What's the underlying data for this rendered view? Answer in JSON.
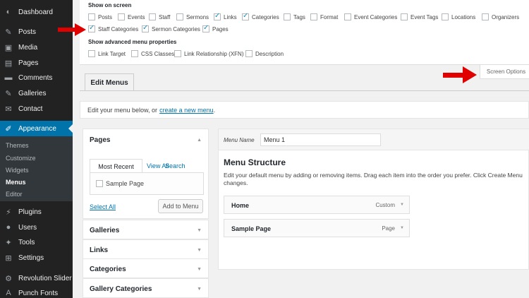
{
  "sidebar": {
    "items": [
      {
        "label": "Dashboard",
        "icon": "dashboard-icon",
        "glyph": "◐"
      },
      {
        "label": "Posts",
        "icon": "pin-icon",
        "glyph": "✎"
      },
      {
        "label": "Media",
        "icon": "media-icon",
        "glyph": "▣"
      },
      {
        "label": "Pages",
        "icon": "pages-icon",
        "glyph": "▤"
      },
      {
        "label": "Comments",
        "icon": "comments-icon",
        "glyph": "▬"
      },
      {
        "label": "Galleries",
        "icon": "pin-icon",
        "glyph": "✎"
      },
      {
        "label": "Contact",
        "icon": "mail-icon",
        "glyph": "✉"
      },
      {
        "label": "Appearance",
        "icon": "brush-icon",
        "glyph": "✐"
      },
      {
        "label": "Plugins",
        "icon": "plug-icon",
        "glyph": "⚡"
      },
      {
        "label": "Users",
        "icon": "user-icon",
        "glyph": "●"
      },
      {
        "label": "Tools",
        "icon": "wrench-icon",
        "glyph": "✦"
      },
      {
        "label": "Settings",
        "icon": "settings-icon",
        "glyph": "⊞"
      },
      {
        "label": "Revolution Slider",
        "icon": "gear-icon",
        "glyph": "⚙"
      },
      {
        "label": "Punch Fonts",
        "icon": "font-icon",
        "glyph": "A"
      }
    ],
    "submenu": [
      "Themes",
      "Customize",
      "Widgets",
      "Menus",
      "Editor"
    ]
  },
  "screen_options": {
    "show_on_screen_heading": "Show on screen",
    "row1": [
      {
        "label": "Posts",
        "checked": false
      },
      {
        "label": "Events",
        "checked": false
      },
      {
        "label": "Staff",
        "checked": false
      },
      {
        "label": "Sermons",
        "checked": false
      },
      {
        "label": "Links",
        "checked": true
      },
      {
        "label": "Categories",
        "checked": true
      },
      {
        "label": "Tags",
        "checked": false
      },
      {
        "label": "Format",
        "checked": false
      },
      {
        "label": "Event Categories",
        "checked": false
      },
      {
        "label": "Event Tags",
        "checked": false
      },
      {
        "label": "Locations",
        "checked": false
      },
      {
        "label": "Organizers",
        "checked": false
      }
    ],
    "row2": [
      {
        "label": "Staff Categories",
        "checked": true
      },
      {
        "label": "Sermon Categories",
        "checked": true
      },
      {
        "label": "Pages",
        "checked": true
      }
    ],
    "advanced_heading": "Show advanced menu properties",
    "row3": [
      {
        "label": "Link Target",
        "checked": false
      },
      {
        "label": "CSS Classes",
        "checked": false
      },
      {
        "label": "Link Relationship (XFN)",
        "checked": false
      },
      {
        "label": "Description",
        "checked": false
      }
    ],
    "tab_label": "Screen Options"
  },
  "tabs": {
    "edit_menus": "Edit Menus"
  },
  "notice": {
    "text": "Edit your menu below, or",
    "link": "create a new menu",
    "suffix": "."
  },
  "pages_box": {
    "title": "Pages",
    "tab_most_recent": "Most Recent",
    "tab_view_all": "View All",
    "tab_search": "Search",
    "item": "Sample Page",
    "select_all": "Select All",
    "add_button": "Add to Menu"
  },
  "collapsed_boxes": [
    "Galleries",
    "Links",
    "Categories",
    "Gallery Categories"
  ],
  "menu": {
    "name_label": "Menu Name",
    "name_value": "Menu 1",
    "structure_title": "Menu Structure",
    "structure_desc": "Edit your default menu by adding or removing items. Drag each item into the order you prefer. Click Create Menu",
    "structure_desc_2": "changes.",
    "items": [
      {
        "title": "Home",
        "type": "Custom"
      },
      {
        "title": "Sample Page",
        "type": "Page"
      }
    ]
  },
  "colors": {
    "accent": "#0073aa",
    "sidebar": "#222222",
    "arrow": "#e00000"
  }
}
